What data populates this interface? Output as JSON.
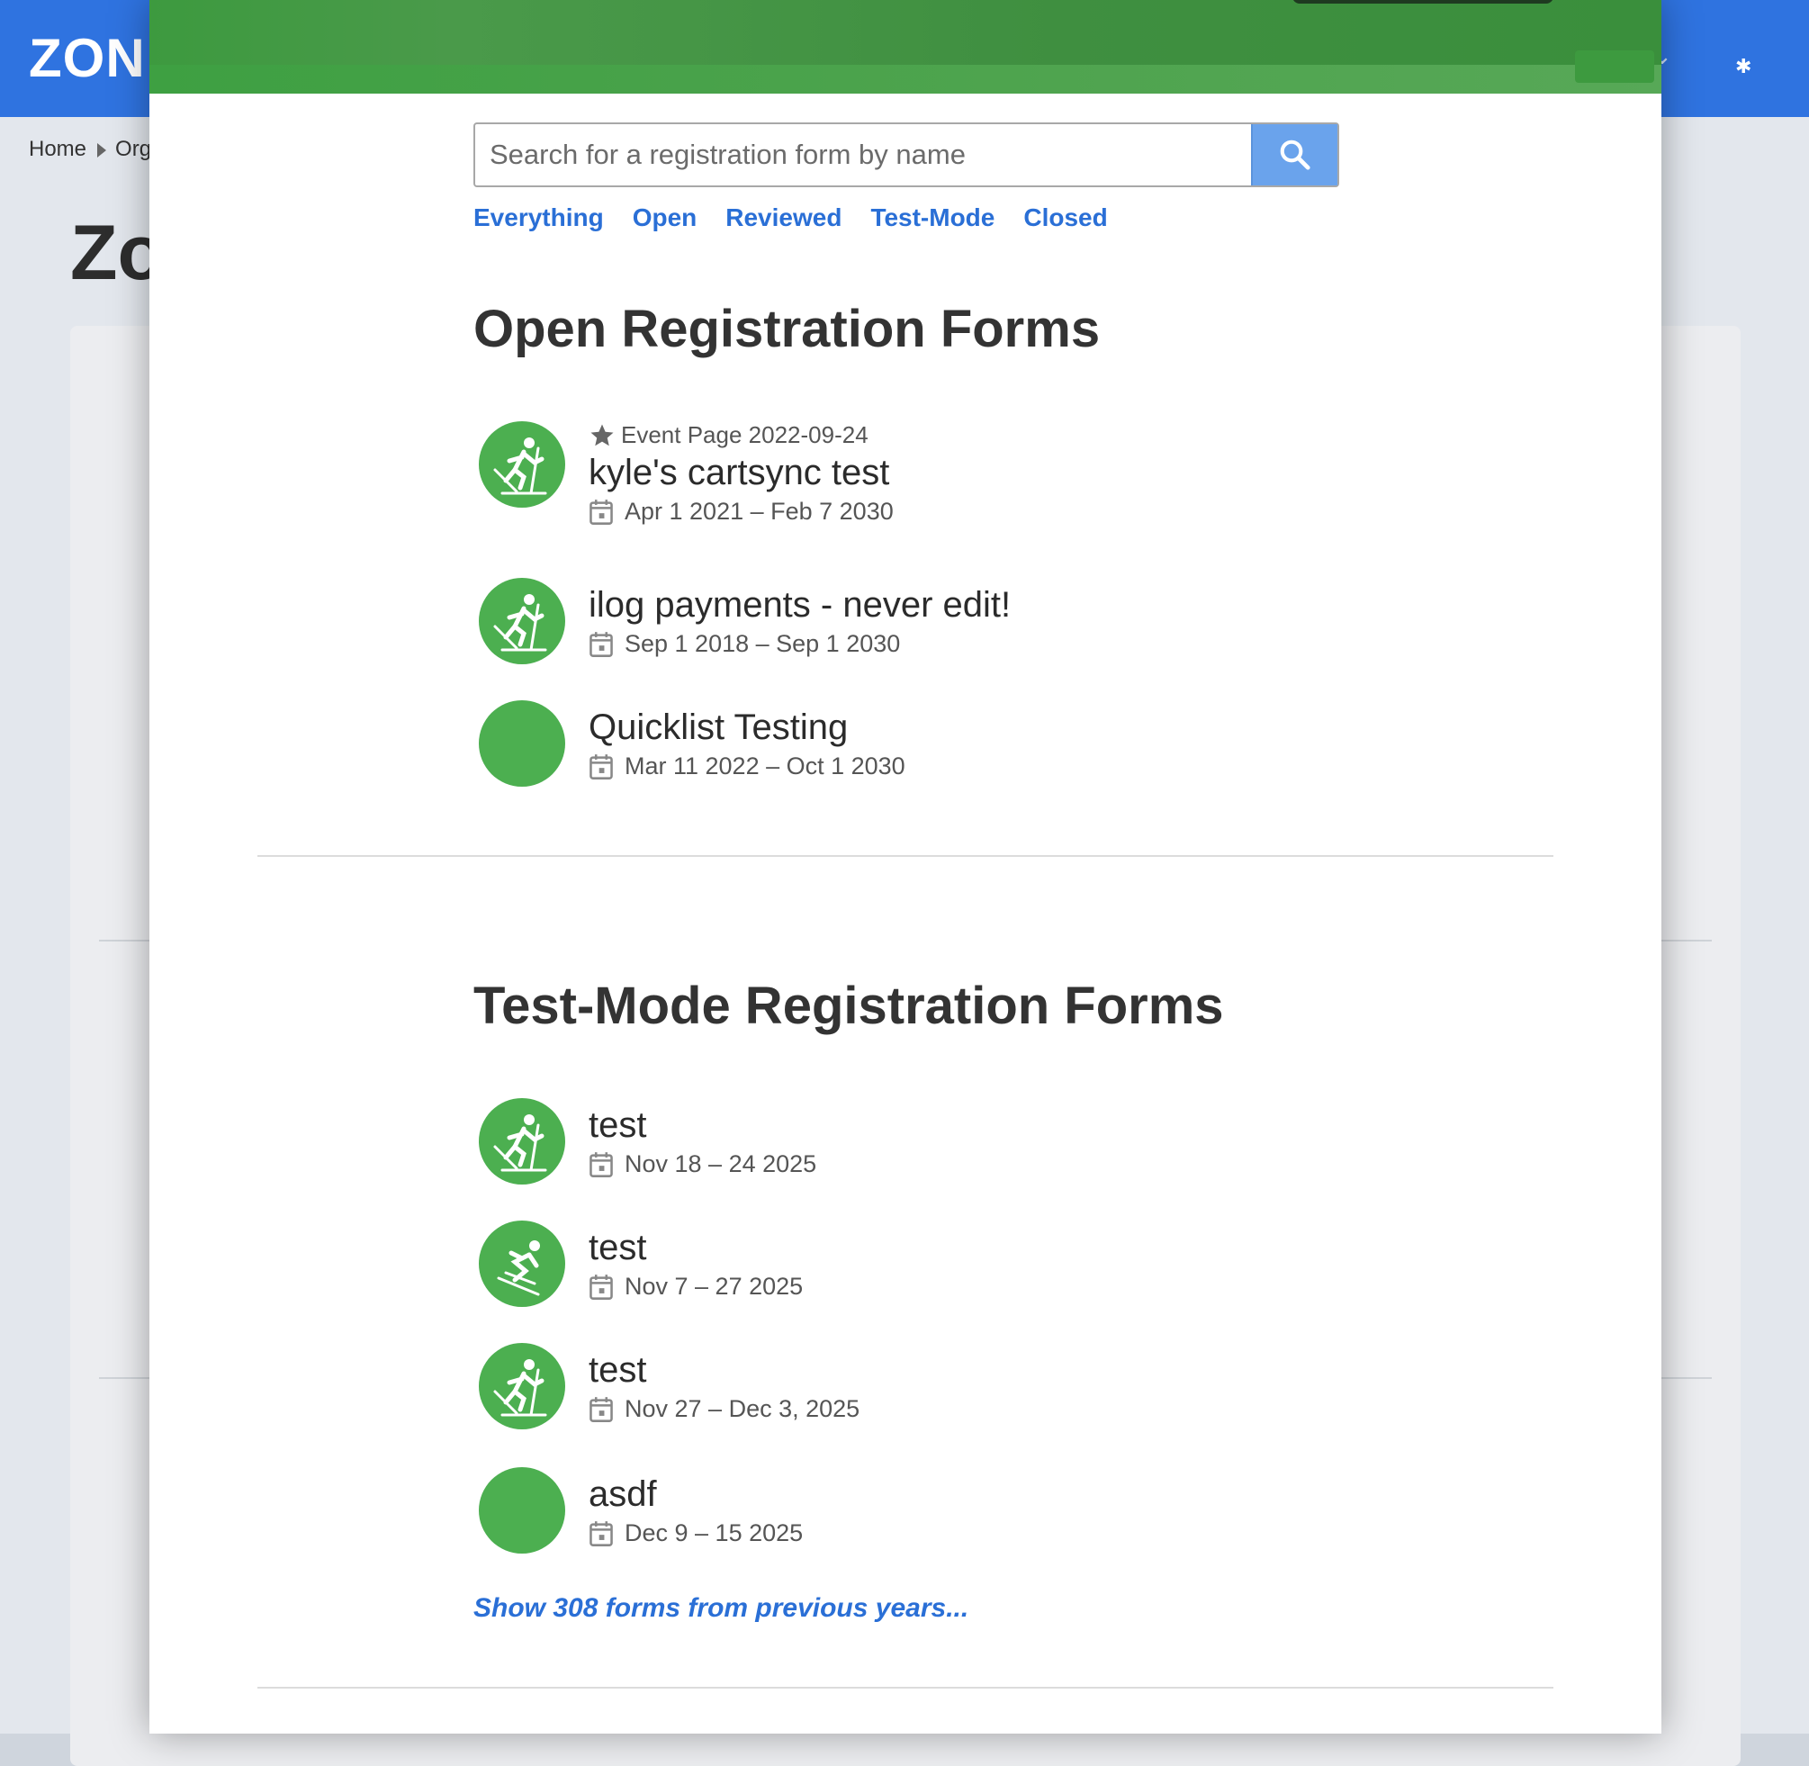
{
  "background": {
    "logo": "ZON",
    "breadcrumb": {
      "home": "Home",
      "next": "Org"
    },
    "page_title": "Zo"
  },
  "search": {
    "placeholder": "Search for a registration form by name",
    "value": ""
  },
  "filters": [
    "Everything",
    "Open",
    "Reviewed",
    "Test-Mode",
    "Closed"
  ],
  "open_section": {
    "title": "Open Registration Forms",
    "items": [
      {
        "meta": "Event Page 2022-09-24",
        "name": "kyle's cartsync test",
        "dates": "Apr 1 2021 – Feb 7 2030",
        "icon": "cross-country-skier-icon"
      },
      {
        "name": "ilog payments - never edit!",
        "dates": "Sep 1 2018 – Sep 1 2030",
        "icon": "cross-country-skier-icon"
      },
      {
        "name": "Quicklist Testing",
        "dates": "Mar 11 2022 – Oct 1 2030",
        "icon": "none"
      }
    ]
  },
  "testmode_section": {
    "title": "Test-Mode Registration Forms",
    "items": [
      {
        "name": "test",
        "dates": "Nov 18 – 24 2025",
        "icon": "cross-country-skier-icon"
      },
      {
        "name": "test",
        "dates": "Nov 7 – 27 2025",
        "icon": "downhill-skier-icon"
      },
      {
        "name": "test",
        "dates": "Nov 27 – Dec 3, 2025",
        "icon": "cross-country-skier-icon"
      },
      {
        "name": "asdf",
        "dates": "Dec 9 – 15 2025",
        "icon": "none"
      }
    ],
    "show_more": "Show 308 forms from previous years..."
  },
  "colors": {
    "brand_green": "#4caf50",
    "link_blue": "#2a6fd6",
    "header_blue": "#2f73e0",
    "search_button": "#6aa3ec"
  }
}
